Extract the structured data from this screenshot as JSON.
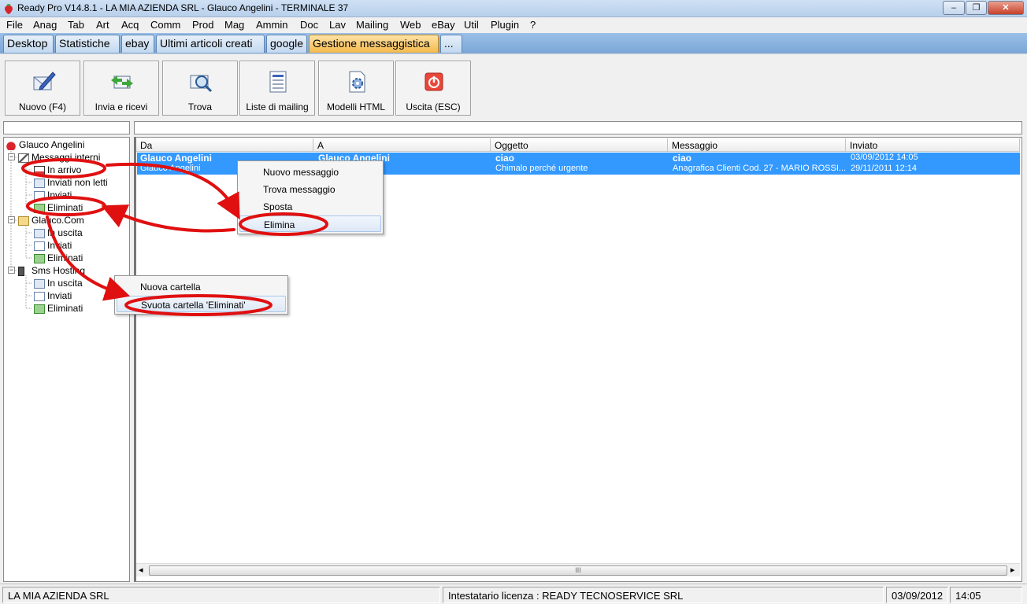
{
  "window": {
    "title": "Ready Pro V14.8.1 - LA MIA AZIENDA SRL - Glauco Angelini - TERMINALE 37",
    "minimize": "–",
    "restore": "❐",
    "close": "✕"
  },
  "menu": [
    "File",
    "Anag",
    "Tab",
    "Art",
    "Acq",
    "Comm",
    "Prod",
    "Mag",
    "Ammin",
    "Doc",
    "Lav",
    "Mailing",
    "Web",
    "eBay",
    "Util",
    "Plugin",
    "?"
  ],
  "tabs": [
    "Desktop",
    "Statistiche",
    "ebay",
    "Ultimi articoli creati",
    "google",
    "Gestione messaggistica",
    "..."
  ],
  "toolbar": [
    "Nuovo (F4)",
    "Invia e ricevi",
    "Trova",
    "Liste di mailing",
    "Modelli HTML",
    "Uscita (ESC)"
  ],
  "tree": {
    "root": "Glauco Angelini",
    "groups": [
      {
        "label": "Messaggi interni",
        "children": [
          "In arrivo",
          "Inviati non letti",
          "Inviati",
          "Eliminati"
        ]
      },
      {
        "label": "Glauco.Com",
        "children": [
          "In uscita",
          "Inviati",
          "Eliminati"
        ]
      },
      {
        "label": "Sms Hosting",
        "children": [
          "In uscita",
          "Inviati",
          "Eliminati"
        ]
      }
    ]
  },
  "table": {
    "columns": [
      "Da",
      "A",
      "Oggetto",
      "Messaggio",
      "Inviato"
    ],
    "rows": [
      [
        "Glauco Angelini",
        "Glauco Angelini",
        "ciao",
        "ciao",
        "03/09/2012 14:05"
      ],
      [
        "Glauco Angelini",
        "",
        "Chimalo perché urgente",
        "Anagrafica Clienti Cod. 27 - MARIO ROSSI...",
        "29/11/2011 12:14"
      ]
    ]
  },
  "context_menu_messages": [
    "Nuovo messaggio",
    "Trova messaggio",
    "Sposta",
    "Elimina"
  ],
  "context_menu_folder": [
    "Nuova cartella",
    "Svuota cartella 'Eliminati'"
  ],
  "scroll": {
    "left": "◂",
    "right": "▸",
    "grip": "III"
  },
  "status": {
    "company": "LA MIA AZIENDA SRL",
    "license": "Intestatario licenza : READY TECNOSERVICE SRL",
    "date": "03/09/2012",
    "time": "14:05"
  },
  "colors": {
    "selection": "#3399ff",
    "annotation": "#e01010",
    "active_tab": "#f6b94c"
  }
}
